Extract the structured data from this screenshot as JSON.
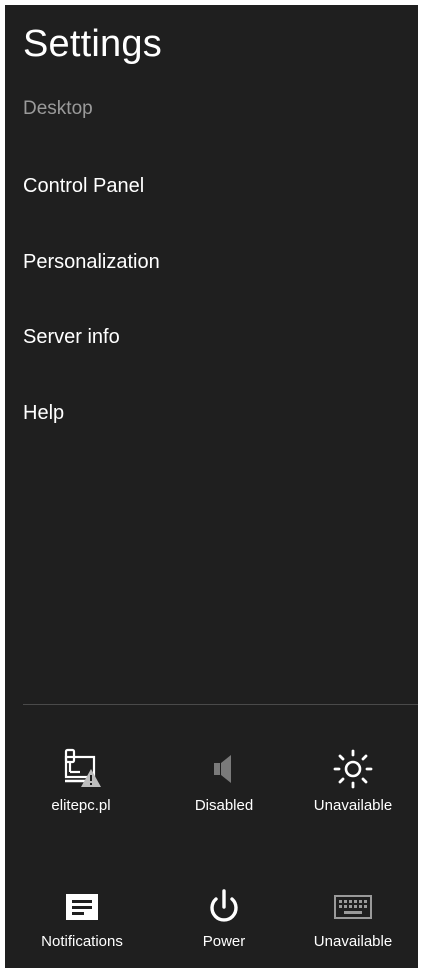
{
  "header": {
    "title": "Settings",
    "subtitle": "Desktop"
  },
  "menu": [
    {
      "label": "Control Panel"
    },
    {
      "label": "Personalization"
    },
    {
      "label": "Server info"
    },
    {
      "label": "Help"
    }
  ],
  "quick_settings": [
    {
      "label": "elitepc.pl",
      "icon": "network-warning-icon"
    },
    {
      "label": "Disabled",
      "icon": "volume-icon"
    },
    {
      "label": "Unavailable",
      "icon": "brightness-icon"
    },
    {
      "label": "Notifications",
      "icon": "notifications-icon"
    },
    {
      "label": "Power",
      "icon": "power-icon"
    },
    {
      "label": "Unavailable",
      "icon": "keyboard-icon"
    }
  ],
  "colors": {
    "panel_bg": "#1f1f1f",
    "text": "#ffffff",
    "muted_text": "#9a9a9a",
    "disabled_icon": "#7a7a7a",
    "divider": "#4a4a4a"
  }
}
